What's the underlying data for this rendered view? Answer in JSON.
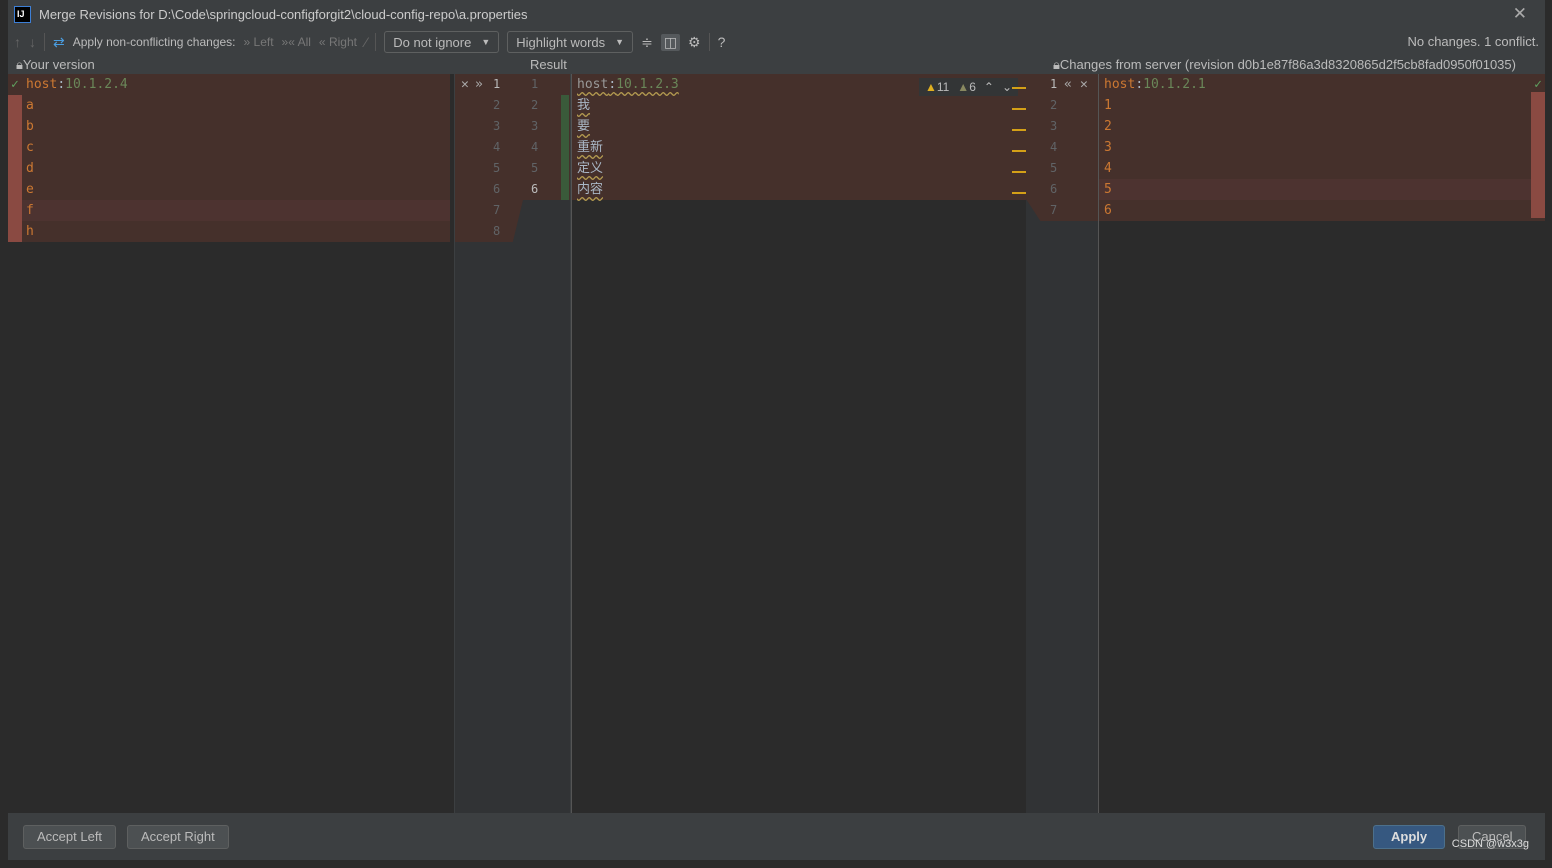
{
  "window": {
    "title": "Merge Revisions for D:\\Code\\springcloud-configforgit2\\cloud-config-repo\\a.properties",
    "logo": "IJ"
  },
  "toolbar": {
    "apply_label": "Apply non-conflicting changes:",
    "left": "Left",
    "all": "All",
    "right": "Right",
    "ignore_select": "Do not ignore",
    "highlight_select": "Highlight words",
    "status": "No changes. 1 conflict.",
    "icons": [
      "arrow-up-icon",
      "arrow-down-icon",
      "magic-resolve-icon",
      "collapse-icon",
      "sync-scroll-icon",
      "gear-icon",
      "help-icon"
    ]
  },
  "headers": {
    "left": "Your version",
    "center": "Result",
    "right": "Changes from server (revision d0b1e87f86a3d8320865d2f5cb8fad0950f01035)"
  },
  "left": {
    "lines": [
      "a",
      "b",
      "c",
      "d",
      "e",
      "f",
      "h"
    ],
    "first": {
      "key": "host",
      "sep": ":",
      "val": "10.1.2.4"
    },
    "numbers": [
      "1",
      "2",
      "3",
      "4",
      "5",
      "6",
      "7",
      "8"
    ]
  },
  "center": {
    "first": {
      "key": "host",
      "sep": ":",
      "val": "10.1.2.3"
    },
    "lines": [
      "我",
      "要",
      "重新",
      "定义",
      "内容"
    ],
    "numbers": [
      "1",
      "2",
      "3",
      "4",
      "5",
      "6"
    ],
    "warnings": "11",
    "weak_warnings": "6"
  },
  "right": {
    "first": {
      "key": "host",
      "sep": ":",
      "val": "10.1.2.1"
    },
    "lines": [
      "1",
      "2",
      "3",
      "4",
      "5",
      "6"
    ],
    "numbers": [
      "1",
      "2",
      "3",
      "4",
      "5",
      "6",
      "7"
    ]
  },
  "buttons": {
    "accept_left": "Accept Left",
    "accept_right": "Accept Right",
    "apply": "Apply",
    "cancel": "Cancel"
  },
  "watermark": "CSDN @w3x3g",
  "colors": {
    "conflict": "#45302b",
    "accent": "#365880"
  }
}
